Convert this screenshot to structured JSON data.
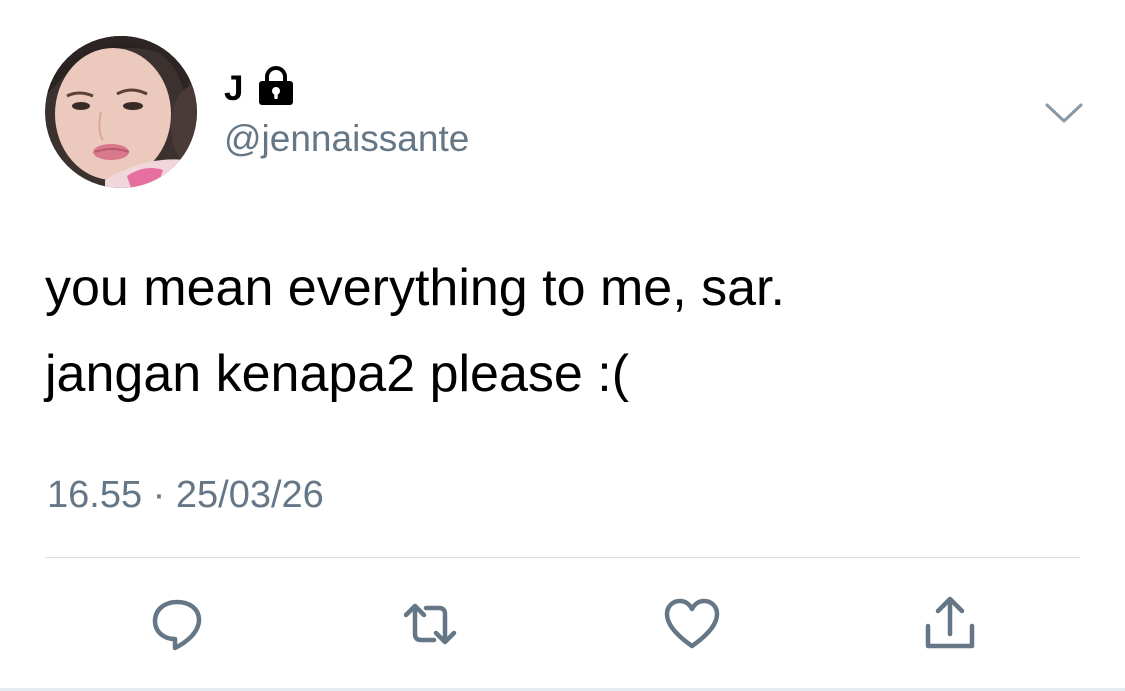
{
  "tweet": {
    "display_name": "J",
    "handle": "@jennaissante",
    "text_lines": [
      "you mean everything to me, sar.",
      "jangan kenapa2 please :("
    ],
    "time": "16.55",
    "separator": "·",
    "date": "25/03/26"
  },
  "icons": {
    "lock": "lock-icon",
    "menu": "chevron-down-icon",
    "reply": "reply-icon",
    "retweet": "retweet-icon",
    "like": "heart-icon",
    "share": "share-icon"
  },
  "colors": {
    "text": "#000000",
    "muted": "#657786",
    "divider": "#d7dde1"
  }
}
